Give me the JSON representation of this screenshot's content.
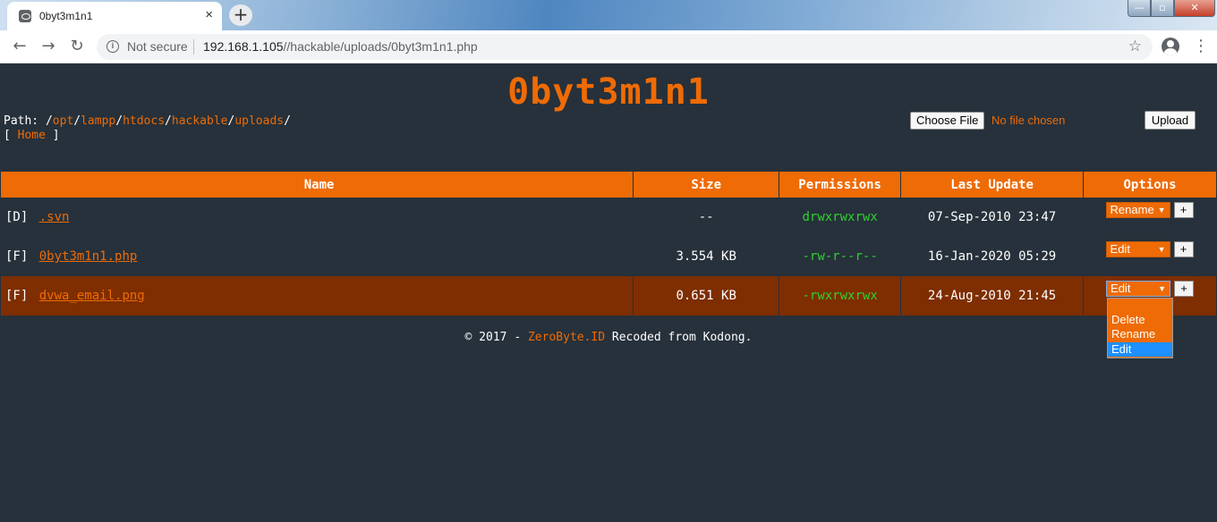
{
  "browser": {
    "tab_title": "0byt3m1n1",
    "tab_close": "×",
    "new_tab": "+",
    "window_controls": {
      "minimize": "—",
      "maximize": "▫",
      "close": "✕"
    },
    "nav": {
      "back": "←",
      "forward": "→",
      "reload": "↻"
    },
    "security_label": "Not secure",
    "url_host": "192.168.1.105",
    "url_path": "//hackable/uploads/0byt3m1n1.php",
    "star": "☆",
    "menu": "⋮"
  },
  "page": {
    "title": "0byt3m1n1",
    "path_label": "Path: ",
    "path_segments": [
      "opt",
      "lampp",
      "htdocs",
      "hackable",
      "uploads"
    ],
    "home_label": "Home",
    "upload": {
      "choose_label": "Choose File",
      "status": "No file chosen",
      "upload_label": "Upload"
    },
    "table": {
      "headers": [
        "Name",
        "Size",
        "Permissions",
        "Last Update",
        "Options"
      ],
      "rows": [
        {
          "type": "[D]",
          "name": ".svn",
          "size": "--",
          "perms": "drwxrwxrwx",
          "date": "07-Sep-2010 23:47",
          "option": "Rename",
          "plus": "+"
        },
        {
          "type": "[F]",
          "name": "0byt3m1n1.php",
          "size": "3.554 KB",
          "perms": "-rw-r--r--",
          "date": "16-Jan-2020 05:29",
          "option": "Edit",
          "plus": "+"
        },
        {
          "type": "[F]",
          "name": "dvwa_email.png",
          "size": "0.651 KB",
          "perms": "-rwxrwxrwx",
          "date": "24-Aug-2010 21:45",
          "option": "Edit",
          "plus": "+"
        }
      ]
    },
    "dropdown": {
      "options": [
        "Delete",
        "Rename",
        "Edit"
      ],
      "selected": "Edit"
    },
    "footer": {
      "prefix": "© 2017 - ",
      "link": "ZeroByte.ID",
      "suffix": " Recoded from Kodong."
    }
  },
  "colors": {
    "background": "#26313b",
    "accent": "#ee6b05",
    "selected_row": "#7e2e00",
    "writable_perm": "#2fd12f",
    "readonly_perm": "#2fd12f"
  }
}
